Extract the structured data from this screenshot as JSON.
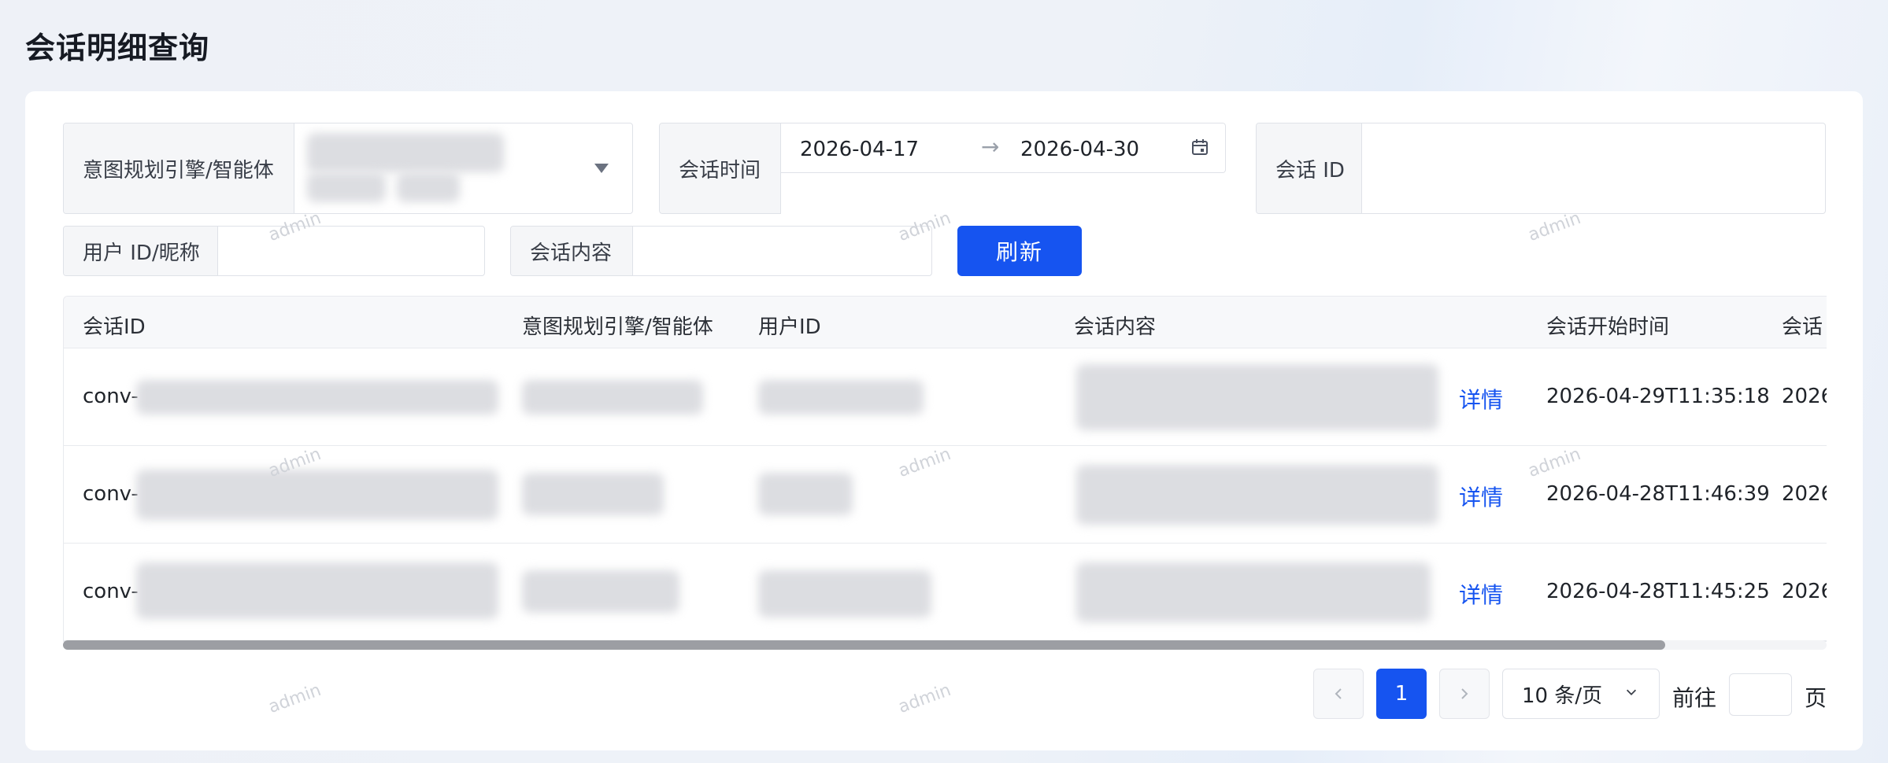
{
  "page": {
    "title": "会话明细查询"
  },
  "filters": {
    "engine_label": "意图规划引擎/智能体",
    "time_label": "会话时间",
    "date_start": "2026-04-17",
    "date_arrow": "→",
    "date_end": "2026-04-30",
    "session_id_label": "会话 ID",
    "session_id_value": "",
    "user_label": "用户 ID/昵称",
    "user_value": "",
    "content_label": "会话内容",
    "content_value": "",
    "refresh_label": "刷新"
  },
  "table": {
    "headers": [
      "会话ID",
      "意图规划引擎/智能体",
      "用户ID",
      "会话内容",
      "会话开始时间",
      "会话"
    ],
    "detail_label": "详情",
    "rows": [
      {
        "id_prefix": "conv-",
        "start_time": "2026-04-29T11:35:18",
        "next_col": "2026"
      },
      {
        "id_prefix": "conv-",
        "start_time": "2026-04-28T11:46:39",
        "next_col": "2026"
      },
      {
        "id_prefix": "conv-",
        "start_time": "2026-04-28T11:45:25",
        "next_col": "2026"
      }
    ]
  },
  "pagination": {
    "prev_icon": "chevron-left-icon",
    "next_icon": "chevron-right-icon",
    "current_page": "1",
    "page_size": "10 条/页",
    "goto_label": "前往",
    "goto_value": "",
    "page_suffix": "页"
  },
  "watermark": "admin",
  "colors": {
    "primary": "#1654f0",
    "header_bg": "#f7f8fa"
  }
}
